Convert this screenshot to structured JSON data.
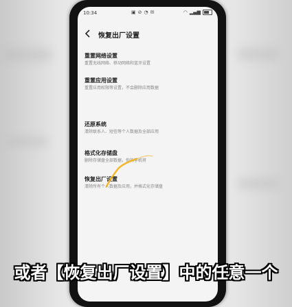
{
  "status_bar": {
    "time": "10:34",
    "icons": [
      "▣",
      "⊘",
      "◔",
      "✉"
    ],
    "signal": "▂▄▆",
    "wifi": "◠"
  },
  "header": {
    "title": "恢复出厂设置"
  },
  "items": [
    {
      "title": "重置网络设置",
      "desc": "重置无线网络、移动网络和蓝牙设置"
    },
    {
      "title": "重置应用设置",
      "desc": "重置应用权限等设置，不会删除应用数据"
    },
    {
      "title": "还原系统",
      "desc": "清除联系人、短信等个人数据及全部应用"
    },
    {
      "title": "格式化存储盘",
      "desc": "删除存储盘全部数据，你的手机将"
    },
    {
      "title": "恢复出厂设置",
      "desc": "清除所有个人数据及应用，并格式化存储盘"
    }
  ],
  "subtitle": "或者【恢复出厂设置】中的任意一个",
  "colors": {
    "trail": "#f2b21b",
    "screen_bg": "#f4f4f4",
    "phone_frame": "#121212"
  }
}
